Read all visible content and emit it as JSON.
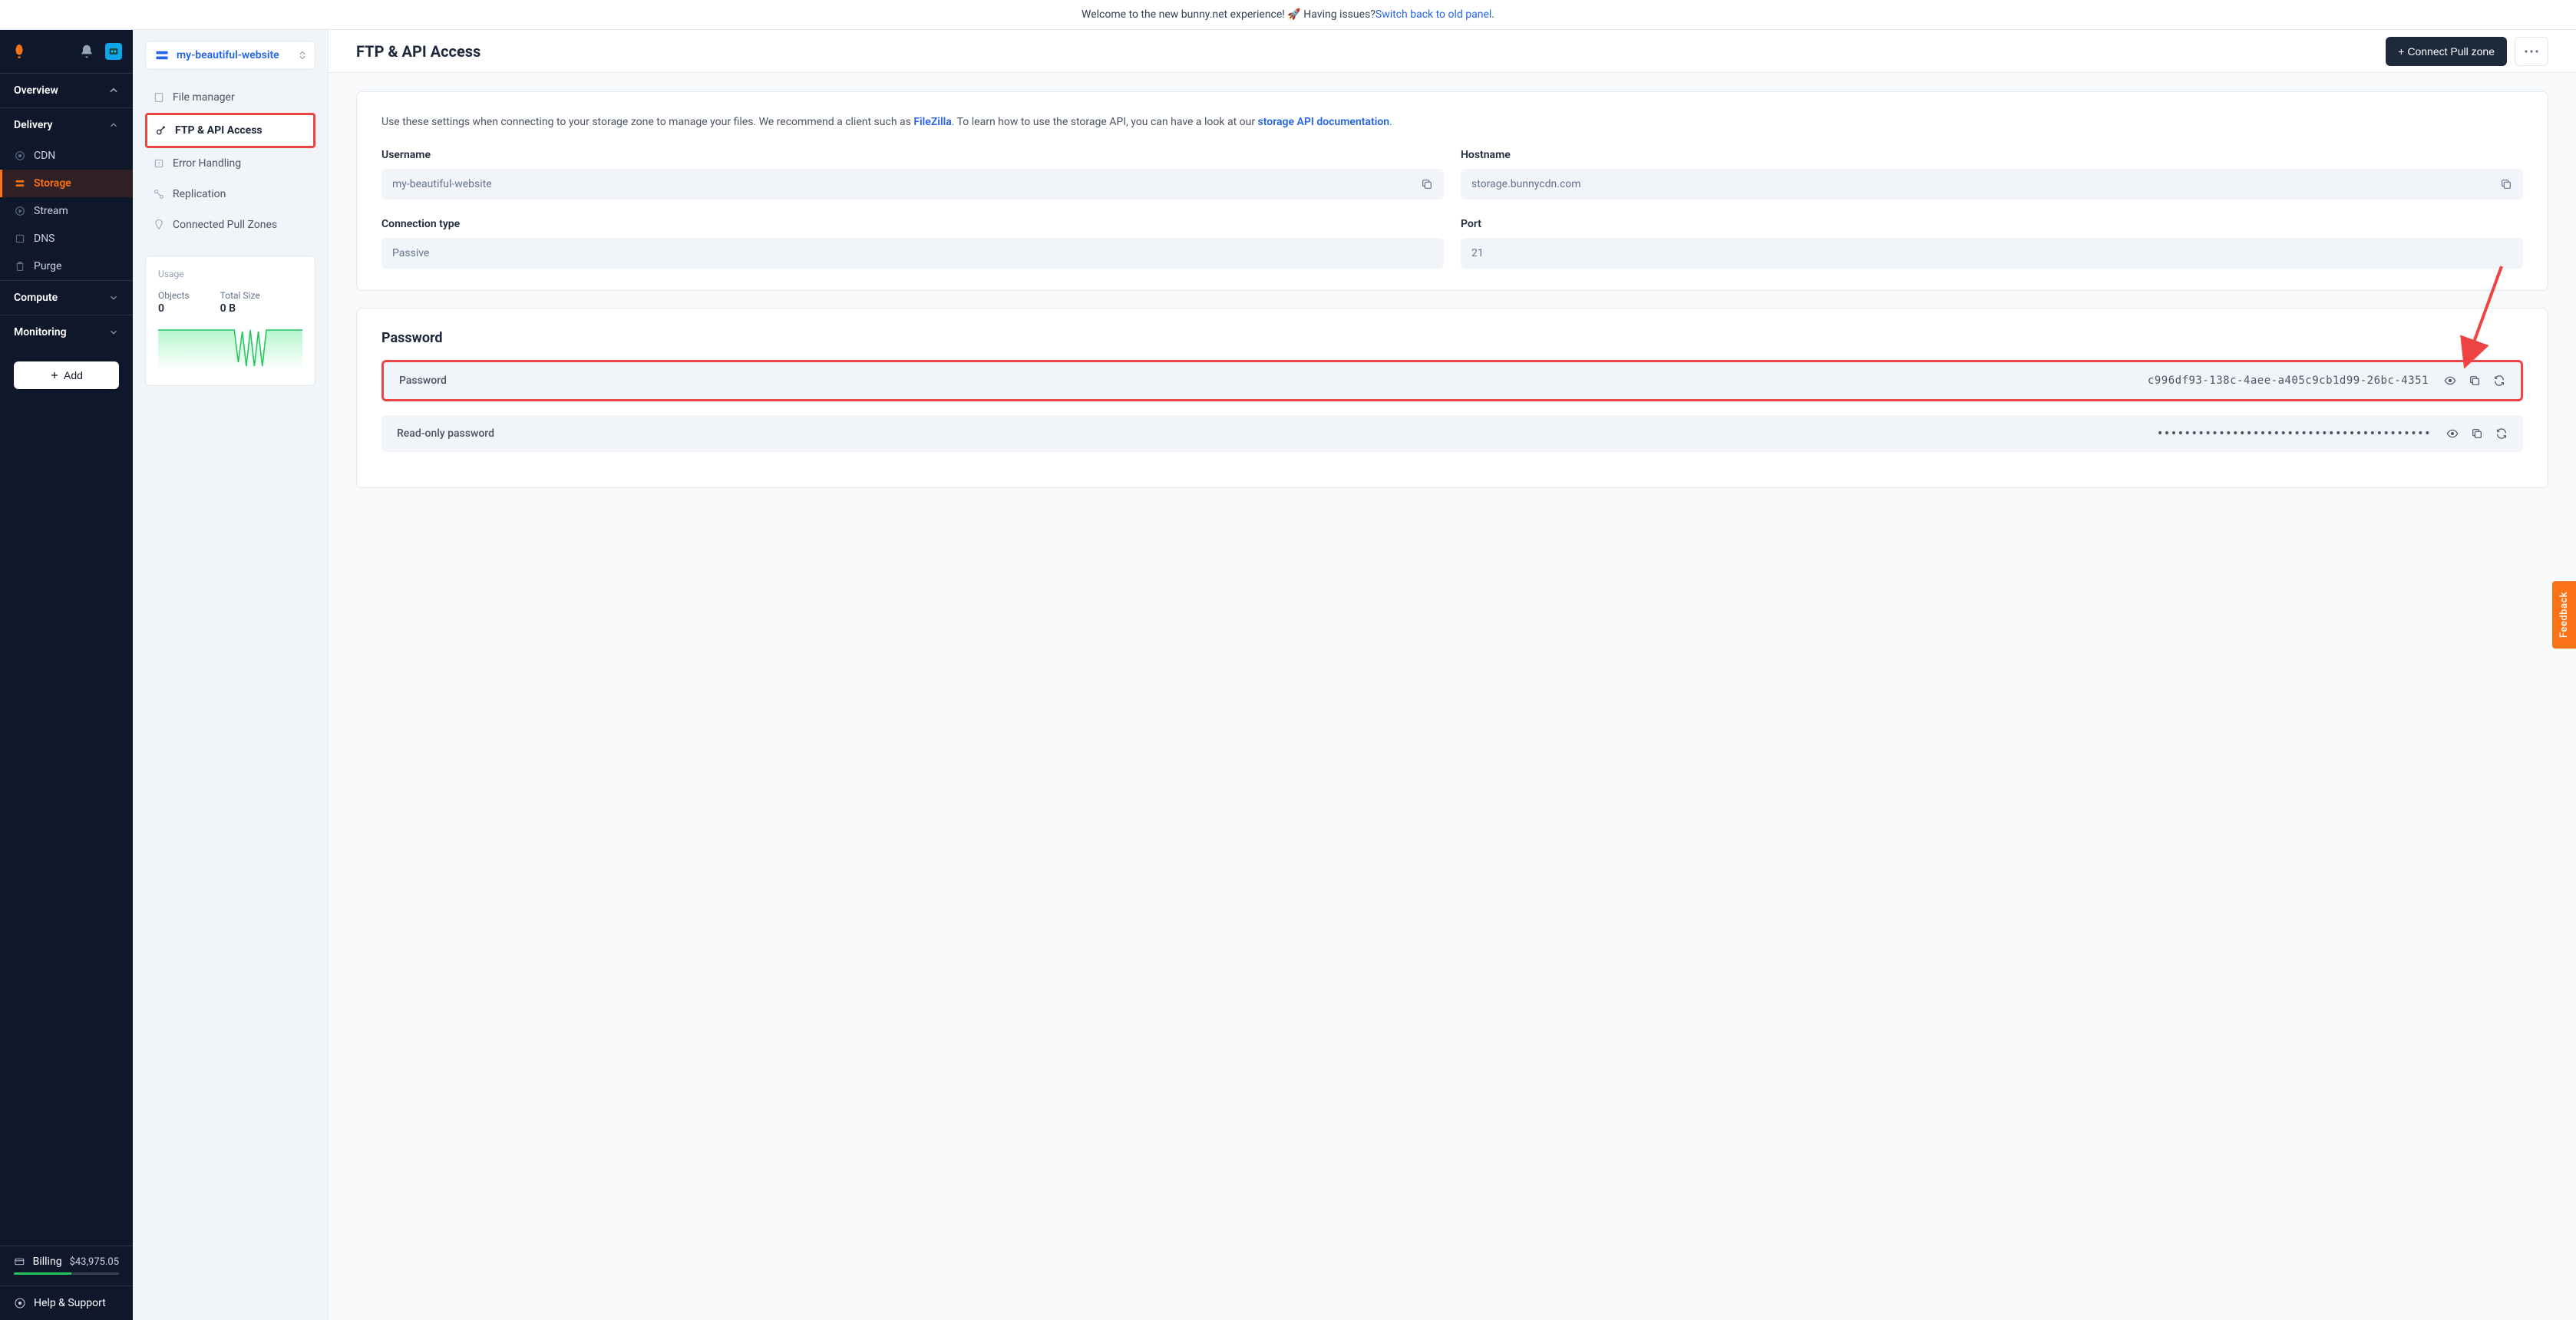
{
  "banner": {
    "text_lead": "Welcome to the new bunny.net experience! 🚀 Having issues? ",
    "link_text": "Switch back to old panel",
    "text_tail": "."
  },
  "sidebar": {
    "sections": {
      "overview": "Overview",
      "delivery": "Delivery",
      "compute": "Compute",
      "monitoring": "Monitoring"
    },
    "delivery_items": {
      "cdn": "CDN",
      "storage": "Storage",
      "stream": "Stream",
      "dns": "DNS",
      "purge": "Purge"
    },
    "add_button": "Add",
    "billing_label": "Billing",
    "billing_amount": "$43,975.05",
    "help_label": "Help & Support"
  },
  "subnav": {
    "zone_name": "my-beautiful-website",
    "items": {
      "file_manager": "File manager",
      "ftp_api": "FTP & API Access",
      "error_handling": "Error Handling",
      "replication": "Replication",
      "connected_zones": "Connected Pull Zones"
    },
    "usage": {
      "title": "Usage",
      "objects_label": "Objects",
      "objects_value": "0",
      "size_label": "Total Size",
      "size_value": "0 B"
    }
  },
  "main": {
    "title": "FTP & API Access",
    "connect_button": "+ Connect Pull zone"
  },
  "settings_card": {
    "intro_1": "Use these settings when connecting to your storage zone to manage your files. We recommend a client such as ",
    "filezilla": "FileZilla",
    "intro_2": ". To learn how to use the storage API, you can have a look at our ",
    "api_doc": "storage API documentation",
    "intro_3": ".",
    "username_label": "Username",
    "username_value": "my-beautiful-website",
    "hostname_label": "Hostname",
    "hostname_value": "storage.bunnycdn.com",
    "conn_type_label": "Connection type",
    "conn_type_value": "Passive",
    "port_label": "Port",
    "port_value": "21"
  },
  "password_card": {
    "title": "Password",
    "pw_label": "Password",
    "pw_value": "c996df93-138c-4aee-a405c9cb1d99-26bc-4351",
    "ro_label": "Read-only password",
    "ro_value": "••••••••••••••••••••••••••••••••••••••••"
  },
  "feedback": {
    "label": "Feedback"
  }
}
